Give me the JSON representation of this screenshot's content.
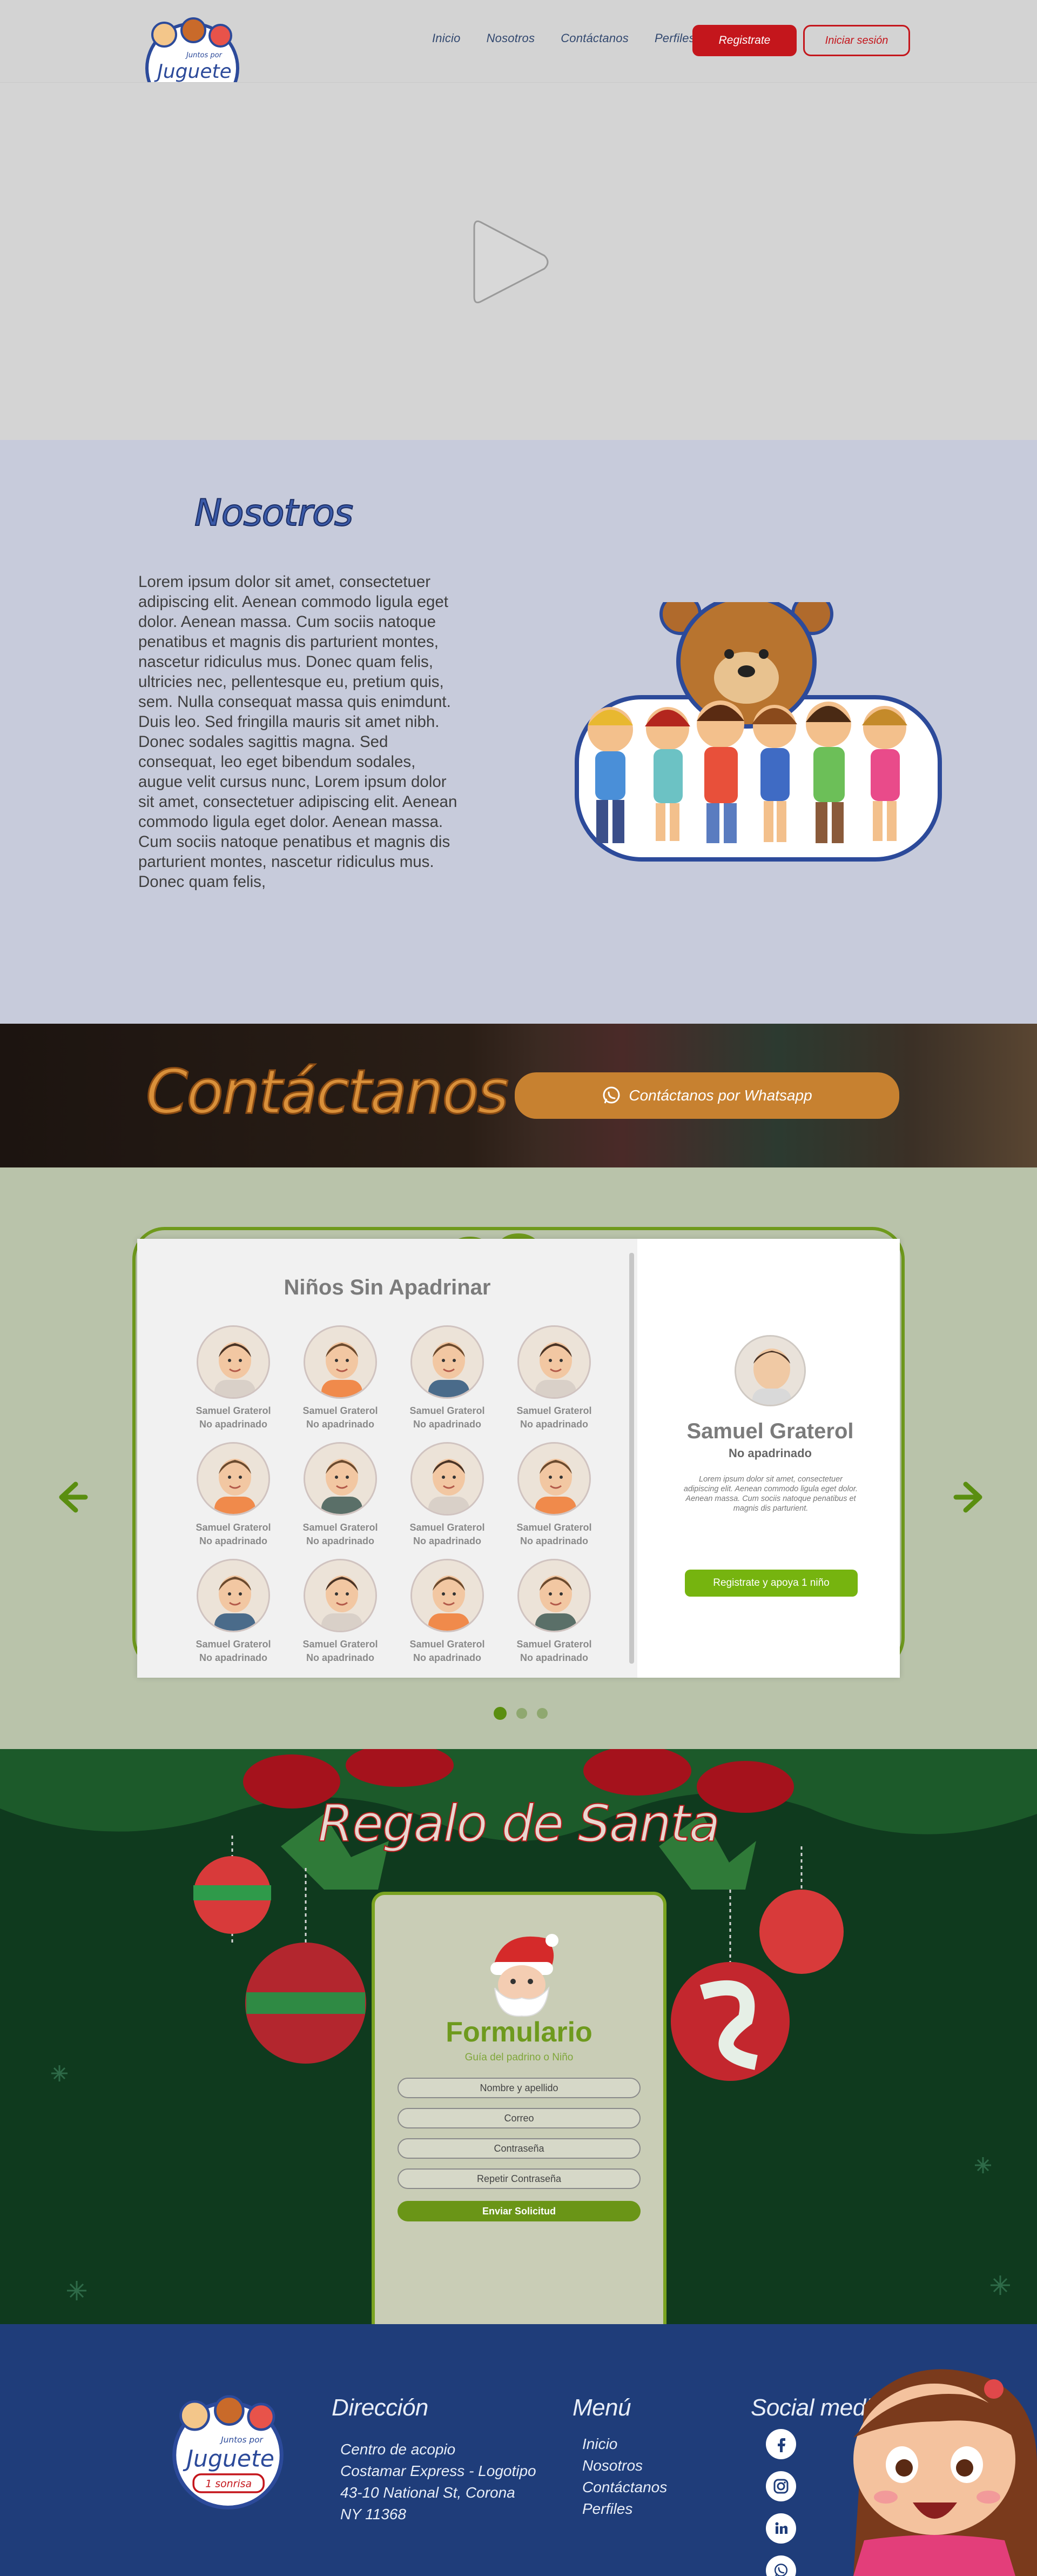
{
  "header": {
    "nav": [
      "Inicio",
      "Nosotros",
      "Contáctanos",
      "Perfiles"
    ],
    "register_label": "Registrate",
    "login_label": "Iniciar sesión"
  },
  "logo": {
    "line1": "Juntos por",
    "line2": "Juguete",
    "line3": "1 sonrisa"
  },
  "nosotros": {
    "title": "Nosotros",
    "text": "Lorem ipsum dolor sit amet, consectetuer adipiscing elit. Aenean commodo ligula eget dolor. Aenean massa. Cum sociis natoque penatibus et magnis dis parturient montes, nascetur ridiculus mus. Donec quam felis, ultricies nec, pellentesque eu, pretium quis, sem. Nulla consequat massa quis enimdunt. Duis leo. Sed fringilla mauris sit amet nibh. Donec sodales sagittis magna. Sed consequat, leo eget bibendum sodales, augue velit cursus nunc, Lorem ipsum dolor sit amet, consectetuer adipiscing elit. Aenean commodo ligula eget dolor. Aenean massa. Cum sociis natoque penatibus et magnis dis parturient montes, nascetur ridiculus mus. Donec quam felis,"
  },
  "contact": {
    "title": "Contáctanos",
    "whatsapp_label": "Contáctanos por Whatsapp"
  },
  "children": {
    "title": "Niños Sin Apadrinar",
    "items": [
      {
        "name": "Samuel Graterol",
        "status": "No apadrinado",
        "shirt": "#d9d0c8"
      },
      {
        "name": "Samuel Graterol",
        "status": "No apadrinado",
        "shirt": "#f08a4b"
      },
      {
        "name": "Samuel Graterol",
        "status": "No apadrinado",
        "shirt": "#4a6b8a"
      },
      {
        "name": "Samuel Graterol",
        "status": "No apadrinado",
        "shirt": "#d9d0c8"
      },
      {
        "name": "Samuel Graterol",
        "status": "No apadrinado",
        "shirt": "#f08a4b"
      },
      {
        "name": "Samuel Graterol",
        "status": "No apadrinado",
        "shirt": "#5a6f68"
      },
      {
        "name": "Samuel Graterol",
        "status": "No apadrinado",
        "shirt": "#d9d0c8"
      },
      {
        "name": "Samuel Graterol",
        "status": "No apadrinado",
        "shirt": "#f08a4b"
      },
      {
        "name": "Samuel Graterol",
        "status": "No apadrinado",
        "shirt": "#4a6b8a"
      },
      {
        "name": "Samuel Graterol",
        "status": "No apadrinado",
        "shirt": "#d9d0c8"
      },
      {
        "name": "Samuel Graterol",
        "status": "No apadrinado",
        "shirt": "#f08a4b"
      },
      {
        "name": "Samuel Graterol",
        "status": "No apadrinado",
        "shirt": "#5a6f68"
      }
    ],
    "detail": {
      "name": "Samuel Graterol",
      "status": "No apadrinado",
      "text": "Lorem ipsum dolor sit amet, consectetuer adipiscing elit. Aenean commodo ligula eget dolor. Aenean massa. Cum sociis natoque penatibus et magnis dis parturient.",
      "button_label": "Registrate y apoya 1 niño"
    }
  },
  "santa": {
    "title": "Regalo de Santa",
    "form_title": "Formulario",
    "form_subtitle": "Guía del padrino o Niño",
    "fields": [
      "Nombre y apellido",
      "Correo",
      "Contraseña",
      "Repetir Contraseña"
    ],
    "submit_label": "Enviar Solicitud"
  },
  "footer": {
    "address_title": "Dirección",
    "address_lines": [
      "Centro de acopio",
      "Costamar Express - Logotipo",
      "43-10 National St, Corona",
      "NY 11368"
    ],
    "menu_title": "Menú",
    "menu_items": [
      "Inicio",
      "Nosotros",
      "Contáctanos",
      "Perfiles"
    ],
    "social_title": "Social media",
    "social_icons": [
      "facebook-icon",
      "instagram-icon",
      "linkedin-icon",
      "whatsapp-icon"
    ]
  },
  "colors": {
    "brand_red": "#c4161c",
    "brand_green": "#76b40f",
    "footer_blue": "#1f3d7a",
    "contact_orange": "#c78130"
  }
}
